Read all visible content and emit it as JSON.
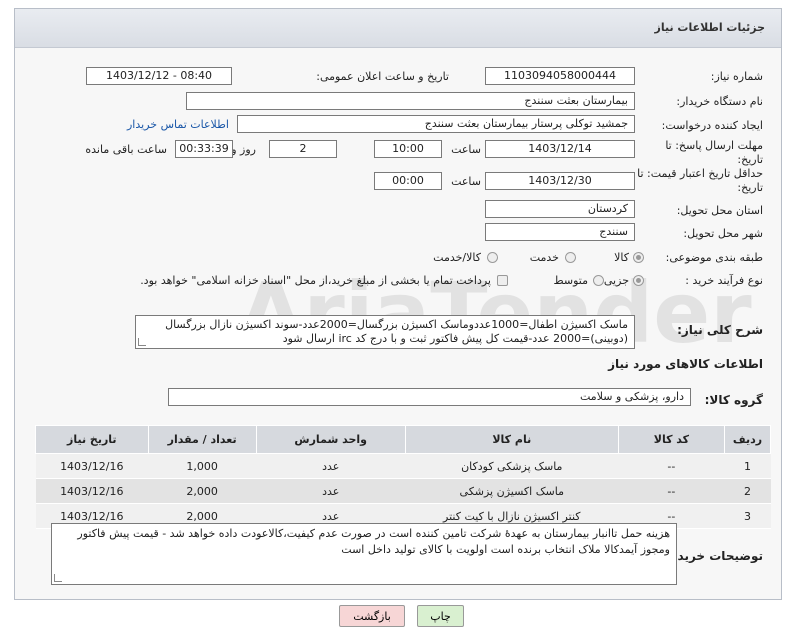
{
  "header": {
    "title": "جزئیات اطلاعات نیاز"
  },
  "fields": {
    "need_number_label": "شماره نیاز:",
    "need_number": "1103094058000444",
    "announce_label": "تاریخ و ساعت اعلان عمومی:",
    "announce_value": "1403/12/12 - 08:40",
    "buyer_org_label": "نام دستگاه خریدار:",
    "buyer_org": "بیمارستان بعثت سنندج",
    "requester_label": "ایجاد کننده درخواست:",
    "requester": "جمشید  توکلی پرستار بیمارستان بعثت سنندج",
    "contact_link": "اطلاعات تماس خریدار",
    "deadline_label": "مهلت ارسال پاسخ: تا تاریخ:",
    "deadline_date": "1403/12/14",
    "time_label": "ساعت",
    "deadline_time": "10:00",
    "days_value": "2",
    "days_label": "روز و",
    "remaining_time": "00:33:39",
    "remaining_label": "ساعت باقی مانده",
    "validity_label": "حداقل تاریخ اعتبار قیمت: تا تاریخ:",
    "validity_date": "1403/12/30",
    "validity_time": "00:00",
    "province_label": "استان محل تحویل:",
    "province": "کردستان",
    "city_label": "شهر محل تحویل:",
    "city": "سنندج",
    "category_label": "طبقه بندی موضوعی:",
    "category_options": [
      "کالا",
      "خدمت",
      "کالا/خدمت"
    ],
    "process_label": "نوع فرآیند خرید :",
    "process_options": [
      "جزیی",
      "متوسط"
    ],
    "payment_note": "پرداخت تمام یا بخشی از مبلغ خرید،از محل \"اسناد خزانه اسلامی\" خواهد بود."
  },
  "description": {
    "label": "شرح کلی نیاز:",
    "text": "ماسک اکسیژن اطفال=1000عددوماسک اکسیژن بزرگسال=2000عدد-سوند اکسیژن نازال بزرگسال (دوبینی)=2000 عدد-قیمت کل پیش فاکتور ثبت و با درج کد irc ارسال شود"
  },
  "goods_info_title": "اطلاعات کالاهای مورد نیاز",
  "goods_group_label": "گروه کالا:",
  "goods_group": "دارو، پزشکی و سلامت",
  "table": {
    "headers": [
      "ردیف",
      "کد کالا",
      "نام کالا",
      "واحد شمارش",
      "تعداد / مقدار",
      "تاریخ نیاز"
    ],
    "rows": [
      [
        "1",
        "--",
        "ماسک پزشکی کودکان",
        "عدد",
        "1,000",
        "1403/12/16"
      ],
      [
        "2",
        "--",
        "ماسک اکسیژن پزشکی",
        "عدد",
        "2,000",
        "1403/12/16"
      ],
      [
        "3",
        "--",
        "کنتر اکسیژن نازال با کیت کنتر",
        "عدد",
        "2,000",
        "1403/12/16"
      ]
    ]
  },
  "buyer_notes": {
    "label": "توضیحات خریدار:",
    "text": "هزینه حمل تاانبار بیمارستان به عهدهٔ شرکت تامین کننده است در صورت عدم کیفیت،کالاعودت داده خواهد شد - قیمت پیش فاکتور ومجوز آیمدکالا ملاک انتخاب برنده است اولویت با کالای تولید داخل است"
  },
  "buttons": {
    "print": "چاپ",
    "back": "بازگشت"
  },
  "colors": {
    "link": "#1a57a8",
    "back_button": "#f7d6d6",
    "print_button": "#d9f0d0"
  }
}
